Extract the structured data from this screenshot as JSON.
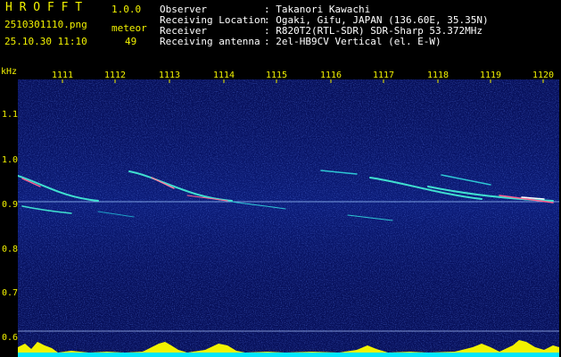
{
  "app": {
    "name": "H R O F F T",
    "version": "1.0.0",
    "filename": "2510301110.png",
    "timestamp": "25.10.30 11:10",
    "meteor_label": "meteor",
    "meteor_count": "49"
  },
  "info": {
    "rows": [
      {
        "label": "Observer",
        "value": ": Takanori Kawachi"
      },
      {
        "label": "Receiving Location",
        "value": ": Ogaki, Gifu, JAPAN (136.60E, 35.35N)"
      },
      {
        "label": "Receiver",
        "value": ": R820T2(RTL-SDR) SDR-Sharp 53.372MHz"
      },
      {
        "label": "Receiving antenna",
        "value": ": 2el-HB9CV Vertical (el. E-W)"
      }
    ]
  },
  "axes": {
    "y_unit": "kHz",
    "x_ticks": [
      "1111",
      "1112",
      "1113",
      "1114",
      "1115",
      "1116",
      "1117",
      "1118",
      "1119",
      "1120"
    ],
    "y_ticks": [
      "1.1",
      "1.0",
      "0.9",
      "0.8",
      "0.7",
      "0.6"
    ]
  },
  "colors": {
    "label": "#f2f200",
    "text": "#ffffff",
    "background": "#07105a",
    "bottom_strip": "#00e6ff",
    "meteor_trail": "#40e0d0"
  }
}
